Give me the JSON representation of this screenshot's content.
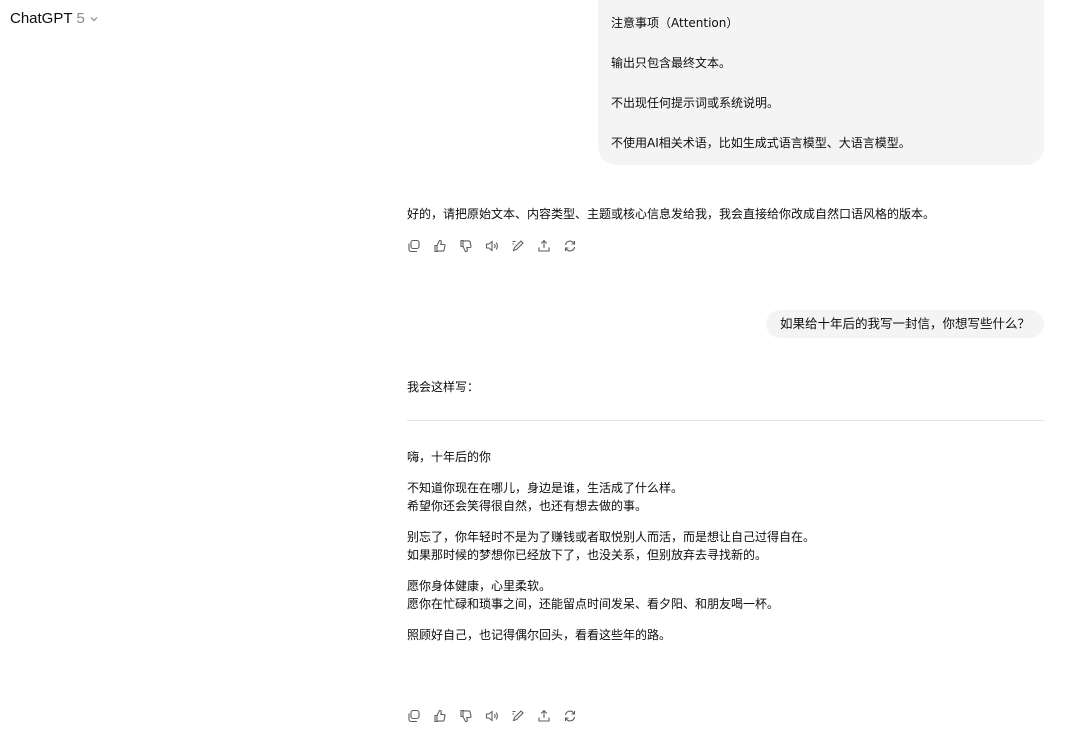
{
  "header": {
    "model_name": "ChatGPT",
    "model_version": "5",
    "chevron_icon": "chevron-down-icon"
  },
  "messages": {
    "user_1": {
      "lines": [
        "注意事项（Attention）",
        "输出只包含最终文本。",
        "不出现任何提示词或系统说明。",
        "不使用AI相关术语，比如生成式语言模型、大语言模型。"
      ]
    },
    "assistant_1": {
      "text": "好的，请把原始文本、内容类型、主题或核心信息发给我，我会直接给你改成自然口语风格的版本。"
    },
    "user_2": {
      "text": "如果给十年后的我写一封信，你想写些什么？"
    },
    "assistant_2": {
      "intro": "我会这样写：",
      "letter": {
        "greeting": "嗨，十年后的你",
        "p1": [
          "不知道你现在在哪儿，身边是谁，生活成了什么样。",
          "希望你还会笑得很自然，也还有想去做的事。"
        ],
        "p2": [
          "别忘了，你年轻时不是为了赚钱或者取悦别人而活，而是想让自己过得自在。",
          "如果那时候的梦想你已经放下了，也没关系，但别放弃去寻找新的。"
        ],
        "p3": [
          "愿你身体健康，心里柔软。",
          "愿你在忙碌和琐事之间，还能留点时间发呆、看夕阳、和朋友喝一杯。"
        ],
        "p4": "照顾好自己，也记得偶尔回头，看看这些年的路。"
      }
    }
  },
  "action_icons": [
    "copy-icon",
    "thumbs-up-icon",
    "thumbs-down-icon",
    "read-aloud-icon",
    "edit-icon",
    "share-icon",
    "regenerate-icon"
  ]
}
